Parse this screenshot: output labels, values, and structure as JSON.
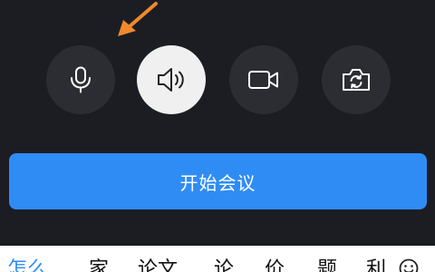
{
  "controls": {
    "microphone": {
      "icon": "microphone-icon",
      "active": false
    },
    "speaker": {
      "icon": "speaker-icon",
      "active": true
    },
    "camera": {
      "icon": "video-camera-icon",
      "active": false
    },
    "switch_camera": {
      "icon": "switch-camera-icon",
      "active": false
    }
  },
  "start_button": {
    "label": "开始会议",
    "color": "#2f8cf5"
  },
  "annotation": {
    "icon": "arrow-icon",
    "color": "#f0892b"
  },
  "keyboard": {
    "suggestions": [
      "怎么",
      "家",
      "论文",
      "论",
      "价",
      "题",
      "利"
    ],
    "emoji_icon": "emoji-icon"
  },
  "colors": {
    "panel_background": "#1c1d23",
    "button_background": "#2c2d33",
    "active_button_background": "#f0f0f0",
    "accent": "#2f8cf5"
  }
}
